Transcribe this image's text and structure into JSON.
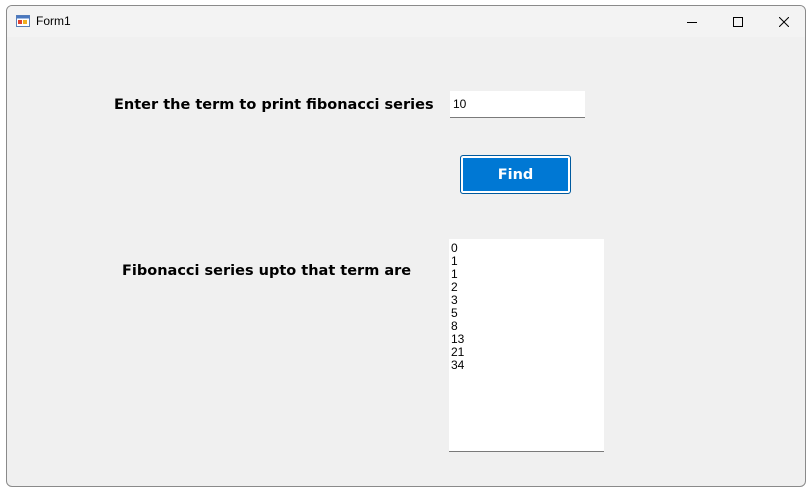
{
  "window": {
    "title": "Form1"
  },
  "form": {
    "term_label": "Enter the term to print fibonacci series",
    "term_value": "10",
    "find_label": "Find",
    "result_label": "Fibonacci series upto that term are",
    "results": [
      "0",
      "1",
      "1",
      "2",
      "3",
      "5",
      "8",
      "13",
      "21",
      "34"
    ]
  },
  "icons": {
    "app": "form-app-icon",
    "minimize": "minimize-icon",
    "maximize": "maximize-icon",
    "close": "close-icon"
  },
  "colors": {
    "accent": "#0078d4",
    "window_bg": "#f0f0f0"
  }
}
